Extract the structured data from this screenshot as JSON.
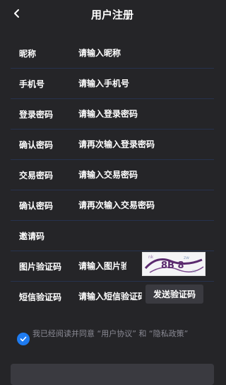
{
  "nav": {
    "title": "用户注册"
  },
  "form": {
    "nickname": {
      "label": "昵称",
      "placeholder": "请输入昵称"
    },
    "phone": {
      "label": "手机号",
      "placeholder": "请输入手机号"
    },
    "login_password": {
      "label": "登录密码",
      "placeholder": "请输入登录密码"
    },
    "confirm_login_password": {
      "label": "确认密码",
      "placeholder": "请再次输入登录密码"
    },
    "trade_password": {
      "label": "交易密码",
      "placeholder": "请输入交易密码"
    },
    "confirm_trade_password": {
      "label": "确认密码",
      "placeholder": "请再次输入交易密码"
    },
    "invite_code": {
      "label": "邀请码",
      "placeholder": ""
    },
    "image_captcha": {
      "label": "图片验证码",
      "placeholder": "请输入图片验证码",
      "captcha_text": "8B 8"
    },
    "sms_code": {
      "label": "短信验证码",
      "placeholder": "请输入短信验证码",
      "send_button": "发送验证码"
    }
  },
  "agreement": {
    "checked": true,
    "prefix": "我已经阅读并同意",
    "user_agreement": "“用户协议”",
    "and": "和",
    "privacy_policy": "“隐私政策”"
  },
  "colors": {
    "background": "#252528",
    "divider": "#27324e",
    "accent": "#1e7bf0"
  }
}
